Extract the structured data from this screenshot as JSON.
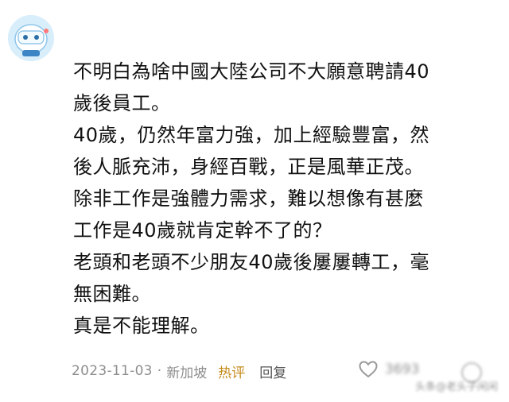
{
  "post": {
    "lines": [
      "不明白為啥中國大陸公司不大願意聘請40",
      "歲後員工。",
      "40歲，仍然年富力強，加上經驗豐富，然",
      "後人脈充沛，身經百戰，正是風華正茂。",
      "除非工作是強體力需求，難以想像有甚麼",
      "工作是40歲就肯定幹不了的？",
      "老頭和老頭不少朋友40歲後屢屢轉工，毫",
      "無困難。",
      "真是不能理解。"
    ]
  },
  "meta": {
    "date": "2023-11-03",
    "separator": "·",
    "location": "新加坡",
    "hot_badge": "热评",
    "reply_label": "回复"
  },
  "like": {
    "icon": "heart-outline-icon",
    "count": "3693"
  },
  "watermark": "头条@老头子闲闲",
  "colors": {
    "text": "#111111",
    "meta": "#8e8e8e",
    "hot": "#c58b1c",
    "avatar_bg": "#d9eefb"
  }
}
